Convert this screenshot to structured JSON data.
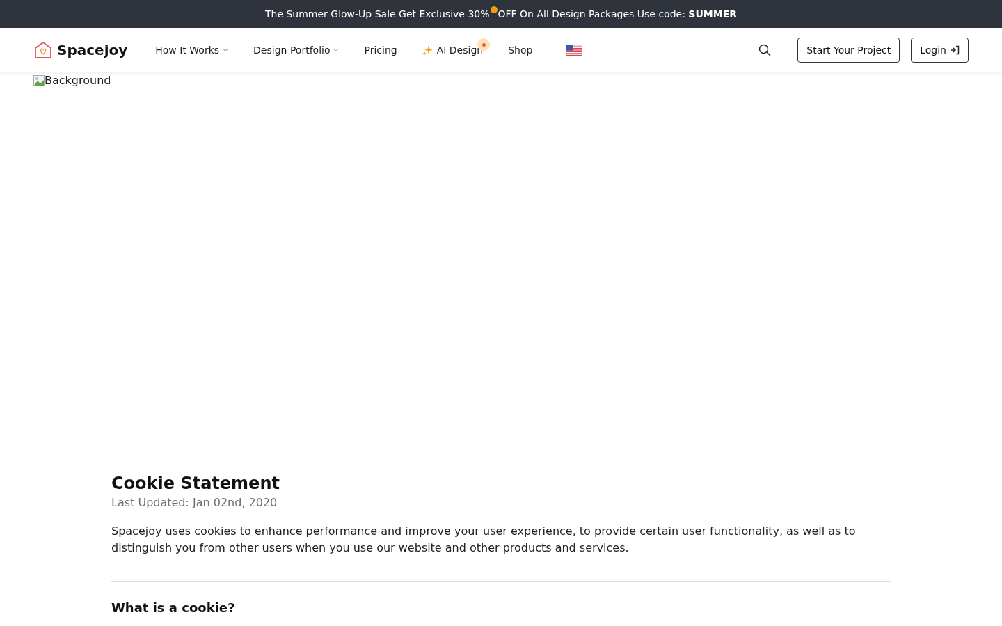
{
  "banner": {
    "texts": [
      "The Summer Glow-Up Sale  Get Exclusive 30%",
      "OFF On All Design Packages Use code: **SUMMER**"
    ]
  },
  "header": {
    "logo": "Spacejoy",
    "nav": [
      {
        "label": "How It Works",
        "kind": "dropdown"
      },
      {
        "label": "Design Portfolio",
        "kind": "dropdown"
      },
      {
        "label": "Pricing",
        "kind": "link"
      },
      {
        "label": "AI Design",
        "kind": "sparkle"
      },
      {
        "label": "Shop",
        "kind": "link"
      }
    ],
    "buttons": [
      {
        "label": "Start Your Project",
        "kind": "plain"
      },
      {
        "label": "Login",
        "kind": "login"
      }
    ]
  },
  "hero": {
    "alt": "Background"
  },
  "article": {
    "title": "Cookie Statement",
    "updated": "Last Updated: Jan 02nd, 2020",
    "intro": "Spacejoy uses cookies to enhance performance and improve your user experience, to provide certain user functionality, as well as to distinguish you from other users when you use our website and other products and services.",
    "sections": [
      {
        "heading": "What is a cookie?"
      }
    ]
  }
}
